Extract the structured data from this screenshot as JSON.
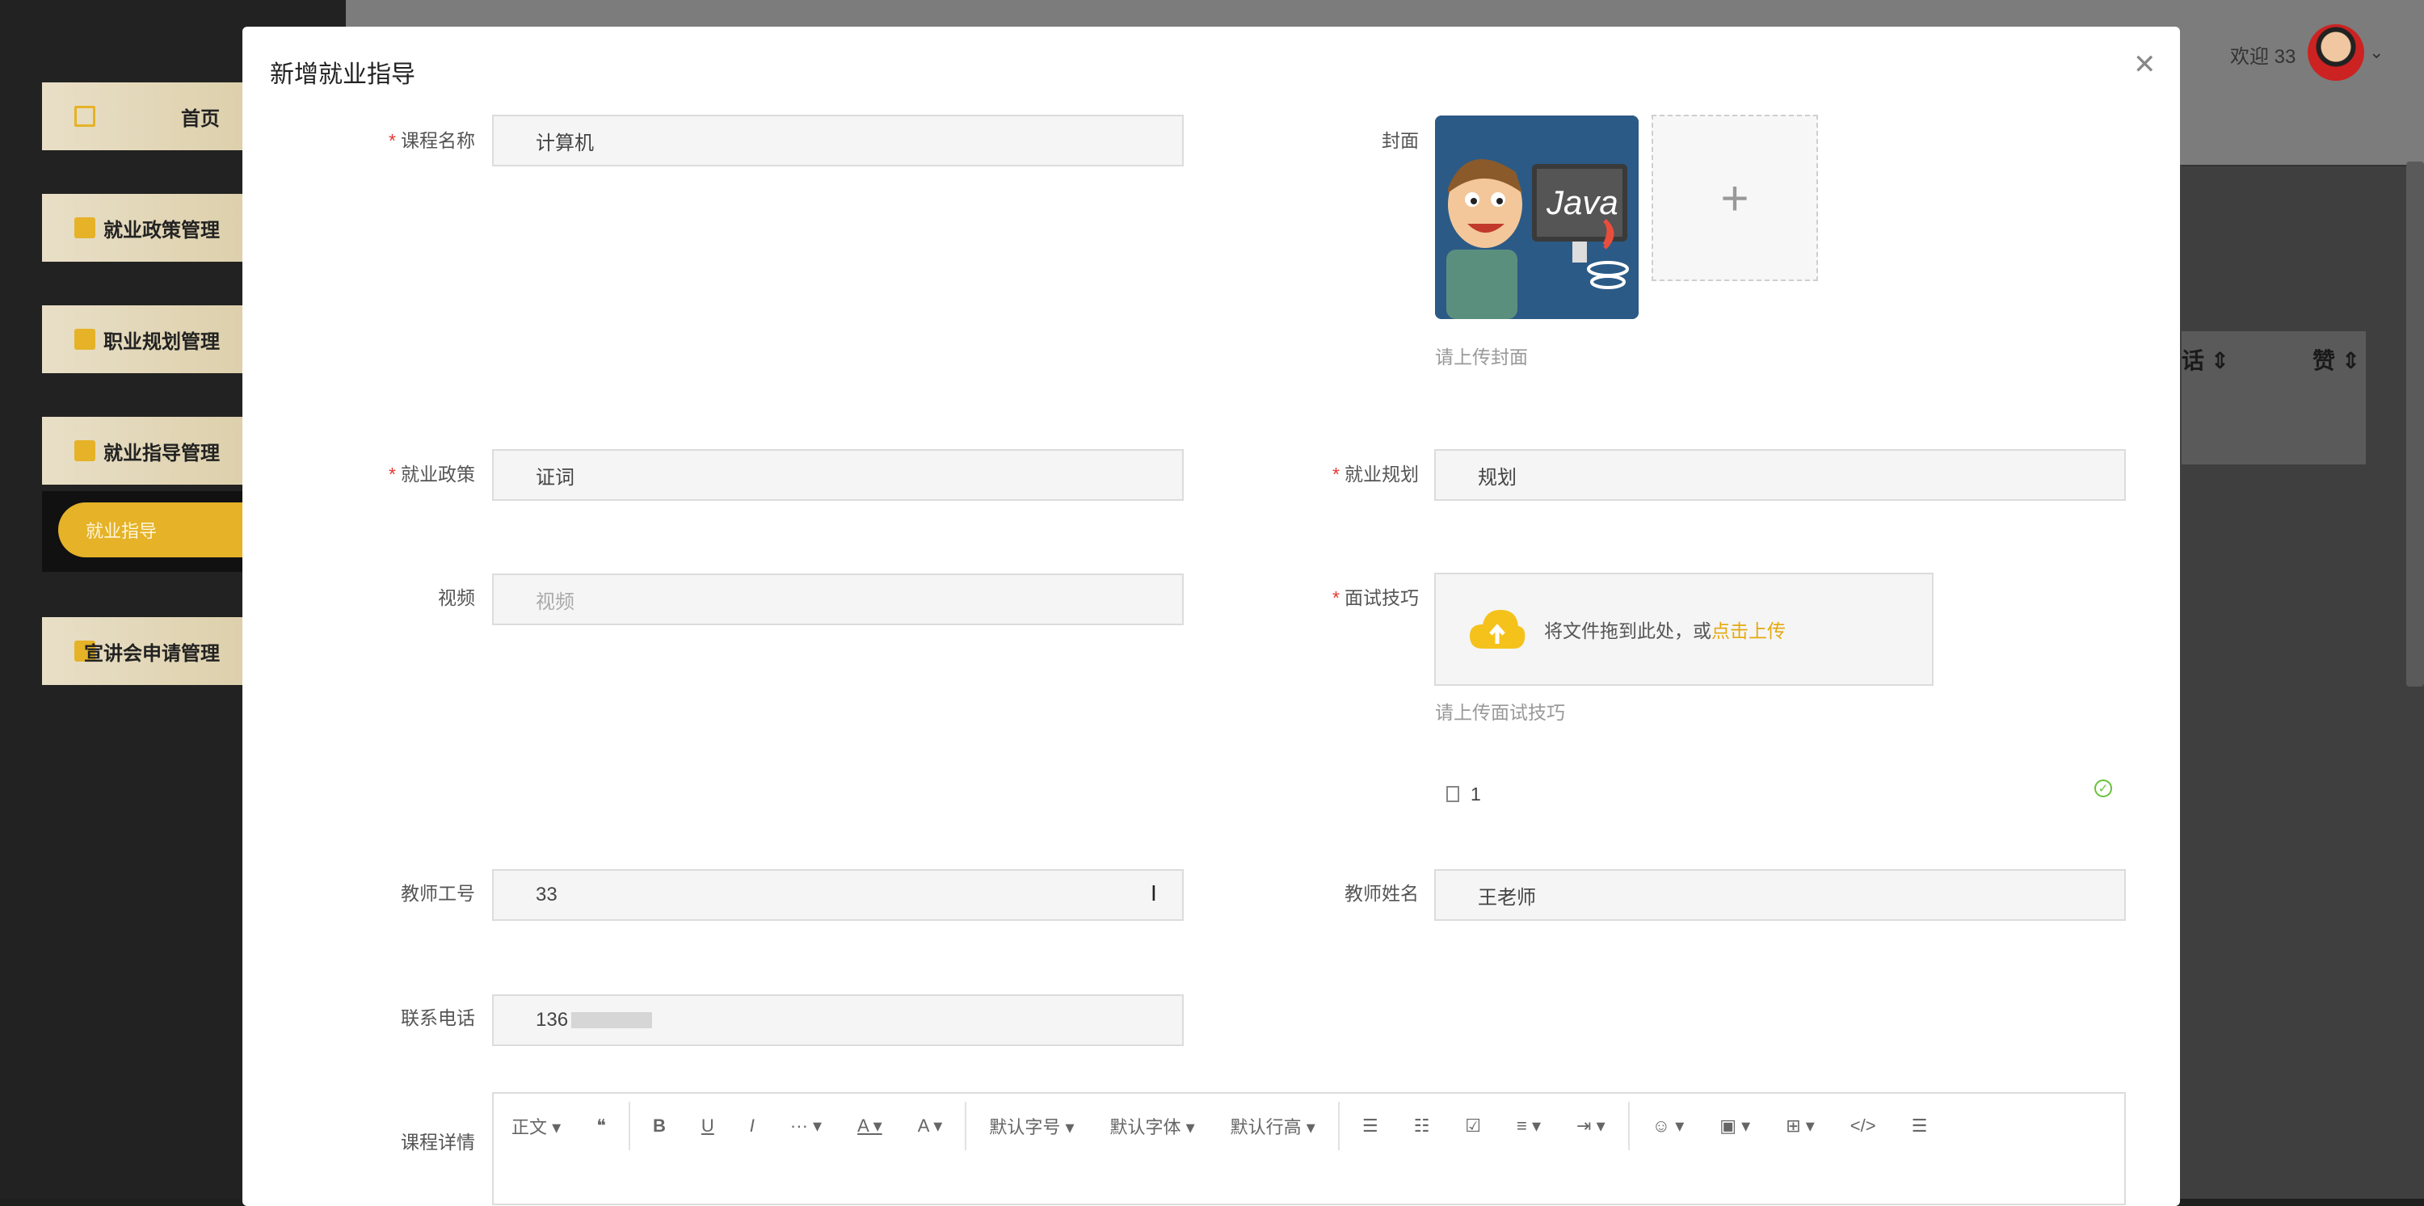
{
  "background": {
    "sidebar": {
      "items": [
        {
          "label": "首页"
        },
        {
          "label": "就业政策管理"
        },
        {
          "label": "职业规划管理"
        },
        {
          "label": "就业指导管理"
        },
        {
          "label": "宣讲会申请管理"
        }
      ],
      "active_sub": "就业指导"
    },
    "header": {
      "welcome": "欢迎 33"
    },
    "table_headers": [
      "话",
      "赞"
    ]
  },
  "modal": {
    "title": "新增就业指导",
    "close_icon": "close-icon",
    "fields": {
      "course_name": {
        "label": "课程名称",
        "value": "计算机",
        "required": true
      },
      "cover": {
        "label": "封面",
        "hint": "请上传封面",
        "image_text": "Java"
      },
      "policy": {
        "label": "就业政策",
        "value": "证词",
        "required": true
      },
      "plan": {
        "label": "就业规划",
        "value": "规划",
        "required": true
      },
      "video": {
        "label": "视频",
        "placeholder": "视频"
      },
      "interview": {
        "label": "面试技巧",
        "required": true,
        "upload_text": "将文件拖到此处，或",
        "upload_link": "点击上传",
        "hint": "请上传面试技巧",
        "file_name": "1"
      },
      "teacher_id": {
        "label": "教师工号",
        "value": "33"
      },
      "teacher_name": {
        "label": "教师姓名",
        "value": "王老师"
      },
      "phone": {
        "label": "联系电话",
        "value": "136"
      },
      "details": {
        "label": "课程详情"
      }
    },
    "editor_toolbar": [
      "正文",
      "❝",
      "B",
      "U",
      "I",
      "···",
      "A",
      "A",
      "默认字号",
      "默认字体",
      "默认行高",
      "☰",
      "☷",
      "☑",
      "≡",
      "⇥",
      "☺",
      "▣",
      "⊞",
      "</>",
      "☰"
    ]
  },
  "colors": {
    "accent": "#e5b228",
    "required": "#e53935",
    "success": "#67c23a"
  }
}
